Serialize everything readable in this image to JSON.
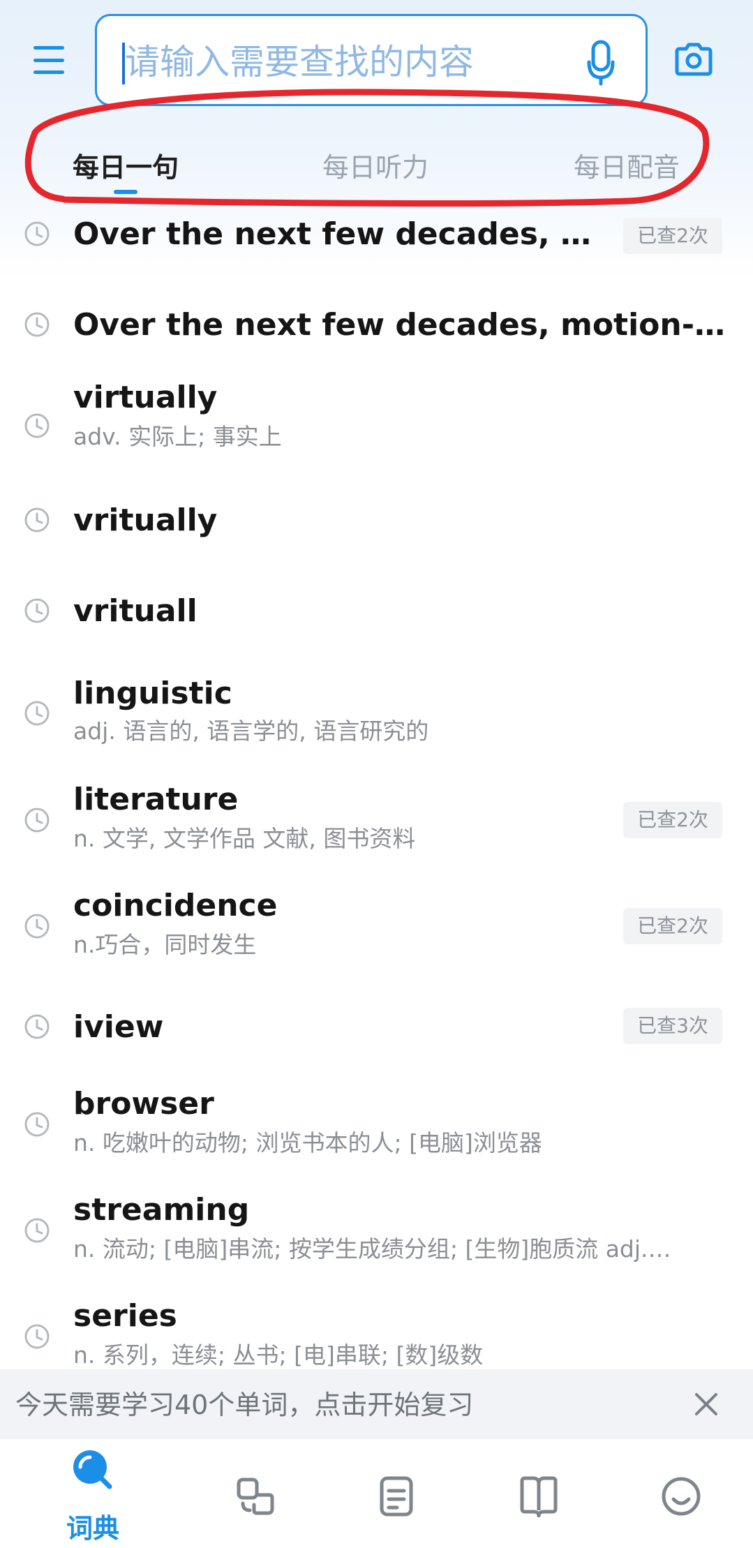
{
  "search": {
    "placeholder": "请输入需要查找的内容"
  },
  "tabs": [
    {
      "label": "每日一句",
      "active": true
    },
    {
      "label": "每日听力",
      "active": false
    },
    {
      "label": "每日配音",
      "active": false
    }
  ],
  "history": [
    {
      "word": "Over the next few decades, moti…",
      "definition": "",
      "badge": "已查2次"
    },
    {
      "word": "Over the next few decades, motion-pictu…",
      "definition": "",
      "badge": ""
    },
    {
      "word": "virtually",
      "definition": "adv. 实际上; 事实上",
      "badge": ""
    },
    {
      "word": "vritually",
      "definition": "",
      "badge": ""
    },
    {
      "word": "vrituall",
      "definition": "",
      "badge": ""
    },
    {
      "word": "linguistic",
      "definition": "adj. 语言的, 语言学的, 语言研究的",
      "badge": ""
    },
    {
      "word": "literature",
      "definition": "n. 文学, 文学作品 文献, 图书资料",
      "badge": "已查2次"
    },
    {
      "word": "coincidence",
      "definition": "n.巧合，同时发生",
      "badge": "已查2次"
    },
    {
      "word": "iview",
      "definition": "",
      "badge": "已查3次"
    },
    {
      "word": "browser",
      "definition": "n. 吃嫩叶的动物; 浏览书本的人; [电脑]浏览器",
      "badge": ""
    },
    {
      "word": "streaming",
      "definition": "n. 流动; [电脑]串流; 按学生成绩分组; [生物]胞质流 adj.…",
      "badge": ""
    },
    {
      "word": "series",
      "definition": "n. 系列，连续; 丛书; [电]串联; [数]级数",
      "badge": ""
    }
  ],
  "review": {
    "text": "今天需要学习40个单词，点击开始复习"
  },
  "nav": {
    "dictionary_label": "词典"
  },
  "colors": {
    "accent": "#1b8ee8",
    "annotation": "#e5262c"
  }
}
